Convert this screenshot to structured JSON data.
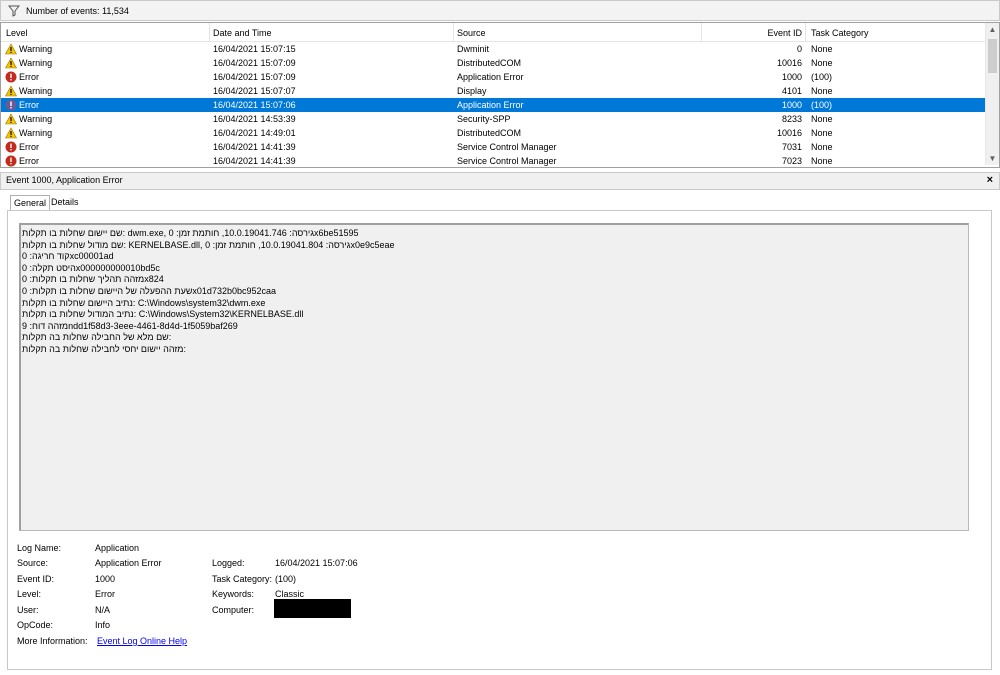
{
  "toolbar": {
    "event_count": "Number of events: 11,534"
  },
  "columns": {
    "level": "Level",
    "date": "Date and Time",
    "source": "Source",
    "event_id": "Event ID",
    "task": "Task Category"
  },
  "events": [
    {
      "level": "Warning",
      "date": "16/04/2021 15:07:15",
      "source": "Dwminit",
      "id": "0",
      "task": "None"
    },
    {
      "level": "Warning",
      "date": "16/04/2021 15:07:09",
      "source": "DistributedCOM",
      "id": "10016",
      "task": "None"
    },
    {
      "level": "Error",
      "date": "16/04/2021 15:07:09",
      "source": "Application Error",
      "id": "1000",
      "task": "(100)"
    },
    {
      "level": "Warning",
      "date": "16/04/2021 15:07:07",
      "source": "Display",
      "id": "4101",
      "task": "None"
    },
    {
      "level": "Error",
      "date": "16/04/2021 15:07:06",
      "source": "Application Error",
      "id": "1000",
      "task": "(100)"
    },
    {
      "level": "Warning",
      "date": "16/04/2021 14:53:39",
      "source": "Security-SPP",
      "id": "8233",
      "task": "None"
    },
    {
      "level": "Warning",
      "date": "16/04/2021 14:49:01",
      "source": "DistributedCOM",
      "id": "10016",
      "task": "None"
    },
    {
      "level": "Error",
      "date": "16/04/2021 14:41:39",
      "source": "Service Control Manager",
      "id": "7031",
      "task": "None"
    },
    {
      "level": "Error",
      "date": "16/04/2021 14:41:39",
      "source": "Service Control Manager",
      "id": "7023",
      "task": "None"
    }
  ],
  "selected_row": 4,
  "detail": {
    "title": "Event 1000, Application Error",
    "close": "×",
    "tabs": [
      "General",
      "Details"
    ],
    "description": [
      "שם יישום שחלות בו תקלות: dwm.exe, גירסה: 10.0.19041.746, חותמת זמן: 0x6be51595",
      "שם מודול שחלות בו תקלות: KERNELBASE.dll, גירסה: 10.0.19041.804, חותמת זמן: 0x0e9c5eae",
      "קוד חריגה: 0xc00001ad",
      "היסט תקלה: 0x000000000010bd5c",
      "מזהה תהליך שחלות בו תקלות: 0x824",
      "שעת ההפעלה של היישום שחלות בו תקלות: 0x01d732b0bc952caa",
      "נתיב היישום שחלות בו תקלות: C:\\Windows\\system32\\dwm.exe",
      "נתיב המודול שחלות בו תקלות: C:\\Windows\\System32\\KERNELBASE.dll",
      "מזהה דוח: 9ndd1f58d3-3eee-4461-8d4d-1f5059baf269",
      "שם מלא של החבילה שחלות בה תקלות:",
      "מזהה יישום יחסי לחבילה שחלות בה תקלות:"
    ],
    "labels": {
      "log_name": "Log Name:",
      "source": "Source:",
      "event_id": "Event ID:",
      "level": "Level:",
      "user": "User:",
      "opcode": "OpCode:",
      "more_info": "More Information:",
      "logged": "Logged:",
      "task_category": "Task Category:",
      "keywords": "Keywords:",
      "computer": "Computer:"
    },
    "values": {
      "log_name": "Application",
      "source": "Application Error",
      "event_id": "1000",
      "level": "Error",
      "user": "N/A",
      "opcode": "Info",
      "more_info_link": "Event Log Online Help",
      "logged": "16/04/2021 15:07:06",
      "task_category": "(100)",
      "keywords": "Classic"
    }
  },
  "colors": {
    "selection": "#0078d7",
    "link": "#0000ee",
    "warning": "#f5c400",
    "error": "#c42b1c"
  }
}
